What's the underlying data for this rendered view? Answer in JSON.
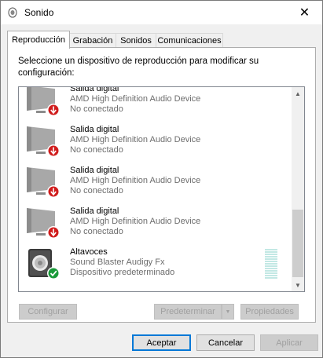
{
  "window": {
    "title": "Sonido",
    "close_glyph": "✕"
  },
  "tabs": [
    {
      "label": "Reproducción",
      "active": true
    },
    {
      "label": "Grabación",
      "active": false
    },
    {
      "label": "Sonidos",
      "active": false
    },
    {
      "label": "Comunicaciones",
      "active": false
    }
  ],
  "instruction": "Seleccione un dispositivo de reproducción para modificar su configuración:",
  "devices": [
    {
      "name": "Salida digital",
      "description": "AMD High Definition Audio Device",
      "status": "No conectado",
      "icon": "monitor-icon",
      "badge": "disconnected-arrow-icon"
    },
    {
      "name": "Salida digital",
      "description": "AMD High Definition Audio Device",
      "status": "No conectado",
      "icon": "monitor-icon",
      "badge": "disconnected-arrow-icon"
    },
    {
      "name": "Salida digital",
      "description": "AMD High Definition Audio Device",
      "status": "No conectado",
      "icon": "monitor-icon",
      "badge": "disconnected-arrow-icon"
    },
    {
      "name": "Salida digital",
      "description": "AMD High Definition Audio Device",
      "status": "No conectado",
      "icon": "monitor-icon",
      "badge": "disconnected-arrow-icon"
    },
    {
      "name": "Altavoces",
      "description": "Sound Blaster Audigy Fx",
      "status": "Dispositivo predeterminado",
      "icon": "speaker-icon",
      "badge": "default-check-icon"
    }
  ],
  "buttons": {
    "configure": "Configurar",
    "set_default": "Predeterminar",
    "properties": "Propiedades",
    "ok": "Aceptar",
    "cancel": "Cancelar",
    "apply": "Aplicar"
  },
  "colors": {
    "disconnected_badge": "#d01c1c",
    "default_badge": "#1a9a3a",
    "level_meter": "#c2e8e4",
    "focus_border": "#0078d7"
  }
}
